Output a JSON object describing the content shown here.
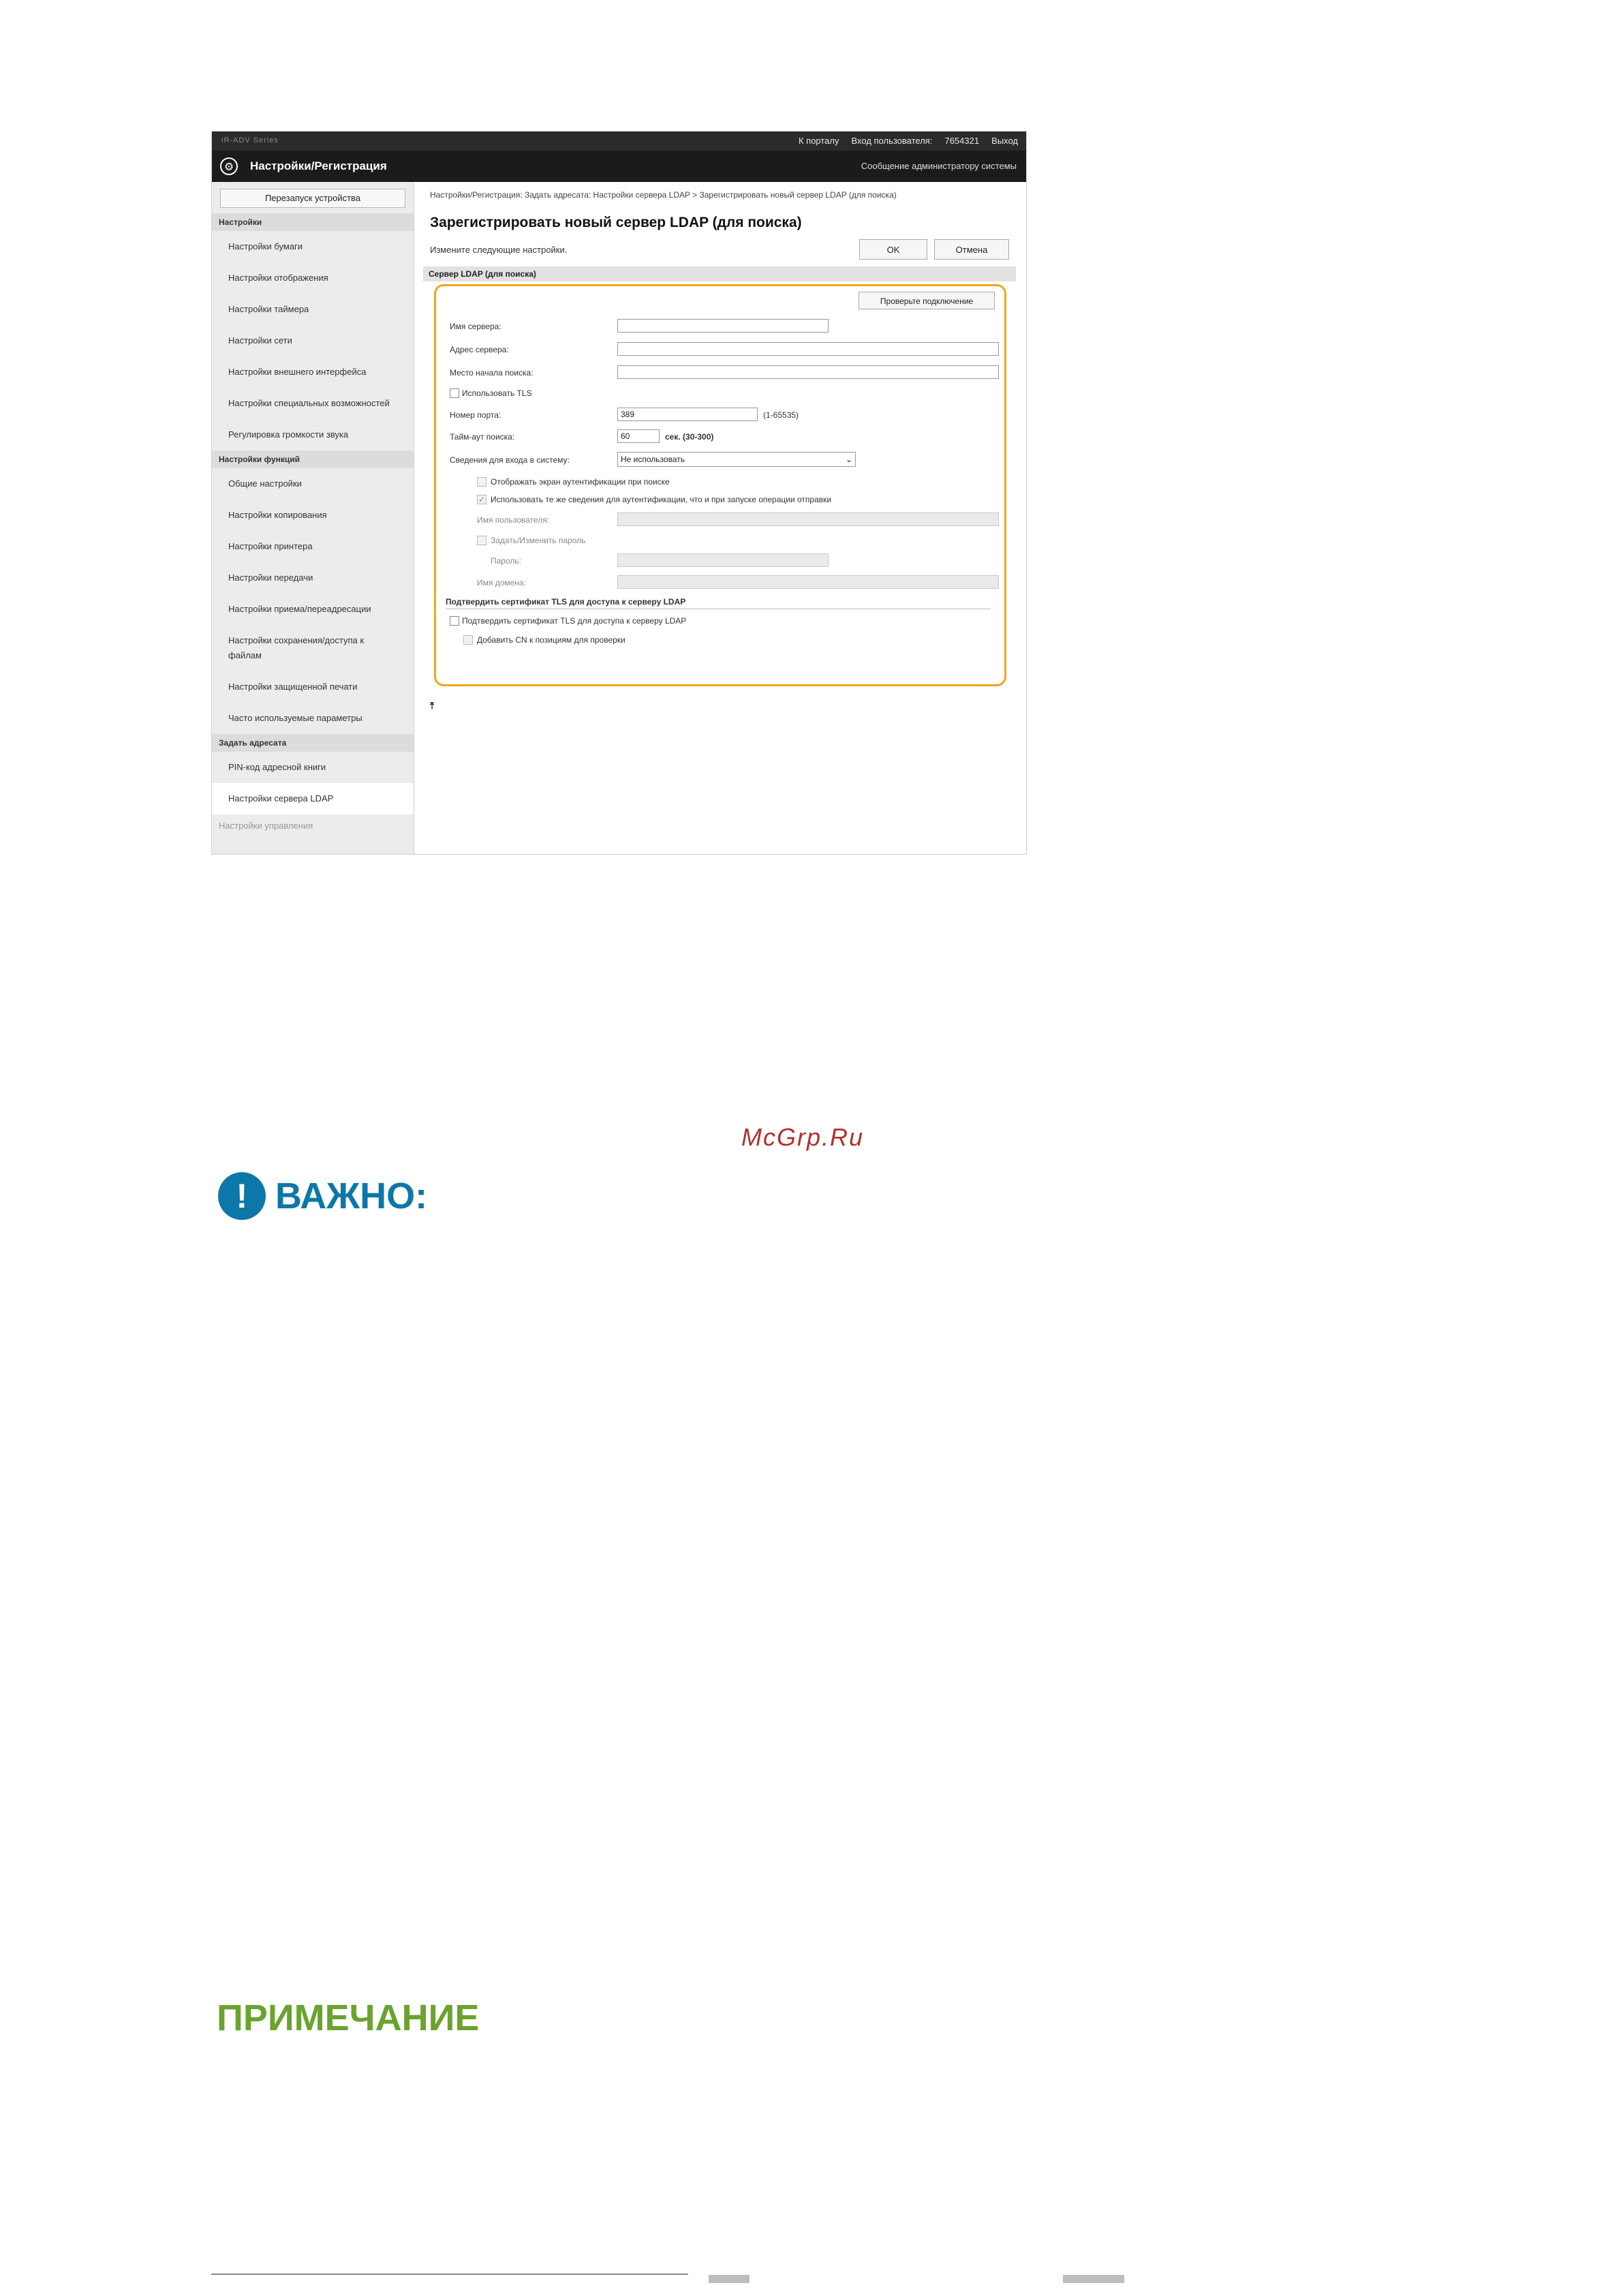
{
  "topbar": {
    "model": "iR-ADV Series",
    "portal": "К порталу",
    "login_label": "Вход пользователя:",
    "login_id": "7654321",
    "logout": "Выход"
  },
  "header": {
    "title": "Настройки/Регистрация",
    "admin_msg": "Сообщение администратору системы"
  },
  "sidebar": {
    "reboot": "Перезапуск устройства",
    "sec1": "Настройки",
    "items1": [
      "Настройки бумаги",
      "Настройки отображения",
      "Настройки таймера",
      "Настройки сети",
      "Настройки внешнего интерфейса",
      "Настройки специальных возможностей",
      "Регулировка громкости звука"
    ],
    "sec2": "Настройки функций",
    "items2": [
      "Общие настройки",
      "Настройки копирования",
      "Настройки принтера",
      "Настройки передачи",
      "Настройки приема/переадресации",
      "Настройки сохранения/доступа к файлам",
      "Настройки защищенной печати",
      "Часто используемые параметры"
    ],
    "sec3": "Задать адресата",
    "items3": [
      "PIN-код адресной книги",
      "Настройки сервера LDAP"
    ],
    "sec4": "Настройки управления"
  },
  "main": {
    "breadcrumb": "Настройки/Регистрация: Задать адресата: Настройки сервера LDAP > Зарегистрировать новый сервер LDAP (для поиска)",
    "title": "Зарегистрировать новый сервер LDAP (для поиска)",
    "instruction": "Измените следующие настройки.",
    "ok": "OK",
    "cancel": "Отмена",
    "section": "Сервер LDAP (для поиска)",
    "check_connection": "Проверьте подключение",
    "server_name": "Имя сервера:",
    "server_address": "Адрес сервера:",
    "search_start": "Место начала поиска:",
    "use_tls": "Использовать TLS",
    "port_label": "Номер порта:",
    "port_value": "389",
    "port_range": "(1-65535)",
    "timeout_label": "Тайм-аут поиска:",
    "timeout_value": "60",
    "timeout_unit": "сек. (30-300)",
    "login_info_label": "Сведения для входа в систему:",
    "login_info_value": "Не использовать",
    "show_auth_screen": "Отображать экран аутентификации при поиске",
    "use_same_auth": "Использовать те же сведения для аутентификации, что и при запуске операции отправки",
    "username": "Имя пользователя:",
    "set_password": "Задать/Изменить пароль",
    "password": "Пароль:",
    "domain": "Имя домена:",
    "tls_section": "Подтвердить сертификат TLS для доступа к серверу LDAP",
    "verify_tls": "Подтвердить сертификат TLS для доступа к серверу LDAP",
    "add_cn": "Добавить CN к позициям для проверки"
  },
  "doc": {
    "watermark": "McGrp.Ru",
    "important": "ВАЖНО:",
    "note": "ПРИМЕЧАНИЕ"
  }
}
